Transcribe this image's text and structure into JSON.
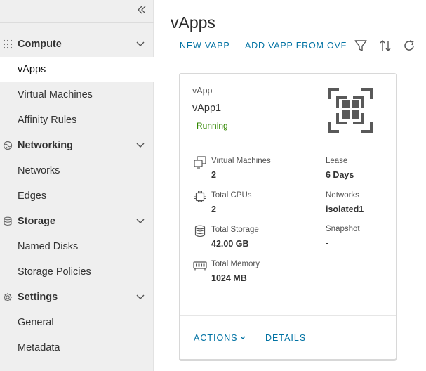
{
  "sidebar": {
    "collapse_icon": "double-chevron-left-icon",
    "sections": [
      {
        "label": "Compute",
        "icon": "grid-dots-icon",
        "items": [
          "vApps",
          "Virtual Machines",
          "Affinity Rules"
        ]
      },
      {
        "label": "Networking",
        "icon": "globe-icon",
        "items": [
          "Networks",
          "Edges"
        ]
      },
      {
        "label": "Storage",
        "icon": "database-icon",
        "items": [
          "Named Disks",
          "Storage Policies"
        ]
      },
      {
        "label": "Settings",
        "icon": "gear-icon",
        "items": [
          "General",
          "Metadata"
        ]
      }
    ],
    "active_item": "vApps"
  },
  "main": {
    "title": "vApps",
    "toolbar": {
      "new_vapp": "NEW VAPP",
      "add_from_ovf": "ADD VAPP FROM OVF",
      "icons": [
        "filter-icon",
        "sort-icon",
        "refresh-icon"
      ]
    },
    "card": {
      "type_label": "vApp",
      "name": "vApp1",
      "status": "Running",
      "stats_left": [
        {
          "label": "Virtual Machines",
          "value": "2",
          "icon": "vm-icon"
        },
        {
          "label": "Total CPUs",
          "value": "2",
          "icon": "cpu-icon"
        },
        {
          "label": "Total Storage",
          "value": "42.00 GB",
          "icon": "storage-icon"
        },
        {
          "label": "Total Memory",
          "value": "1024 MB",
          "icon": "memory-icon"
        }
      ],
      "stats_right": [
        {
          "label": "Lease",
          "value": "6 Days"
        },
        {
          "label": "Networks",
          "value": "isolated1"
        },
        {
          "label": "Snapshot",
          "value": "-"
        }
      ],
      "actions_label": "ACTIONS",
      "details_label": "DETAILS"
    }
  },
  "colors": {
    "link": "#0072a3",
    "status_running": "#318700",
    "sidebar_bg": "#efefef"
  }
}
